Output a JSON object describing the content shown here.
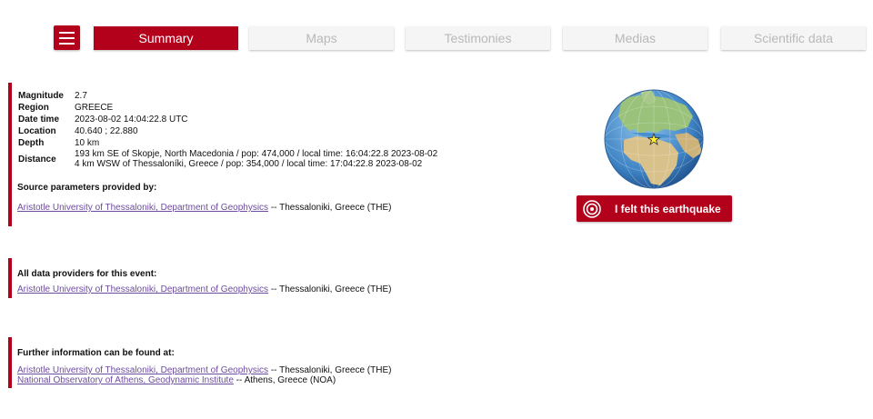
{
  "nav": {
    "tabs": [
      {
        "label": "Summary",
        "active": true
      },
      {
        "label": "Maps",
        "active": false
      },
      {
        "label": "Testimonies",
        "active": false
      },
      {
        "label": "Medias",
        "active": false
      },
      {
        "label": "Scientific data",
        "active": false
      }
    ],
    "menu_icon": "hamburger-menu-icon"
  },
  "event": {
    "rows": [
      {
        "key": "Magnitude",
        "value": "2.7"
      },
      {
        "key": "Region",
        "value": "GREECE"
      },
      {
        "key": "Date time",
        "value": "2023-08-02 14:04:22.8 UTC"
      },
      {
        "key": "Location",
        "value": "40.640 ; 22.880"
      },
      {
        "key": "Depth",
        "value": "10 km"
      }
    ],
    "distance_key": "Distance",
    "distance_lines": [
      "193 km SE of Skopje, North Macedonia / pop: 474,000 / local time: 16:04:22.8 2023-08-02",
      "4 km WSW of Thessaloníki, Greece / pop: 354,000 / local time: 17:04:22.8 2023-08-02"
    ]
  },
  "source": {
    "heading": "Source parameters provided by:",
    "link": "Aristotle University of Thessaloniki, Department of Geophysics",
    "suffix": " -- Thessaloniki, Greece (THE)"
  },
  "providers": {
    "heading": "All data providers for this event:",
    "items": [
      {
        "link": "Aristotle University of Thessaloniki, Department of Geophysics",
        "suffix": " -- Thessaloniki, Greece (THE)"
      }
    ]
  },
  "further": {
    "heading": "Further information can be found at:",
    "items": [
      {
        "link": "Aristotle University of Thessaloniki, Department of Geophysics",
        "suffix": " -- Thessaloniki, Greece (THE)"
      },
      {
        "link": "National Observatory of Athens, Geodynamic Institute",
        "suffix": " -- Athens, Greece (NOA)"
      }
    ]
  },
  "felt_button": {
    "label": "I felt this earthquake",
    "icon": "target-icon"
  },
  "colors": {
    "accent": "#b3001b",
    "link": "#6d4c9f",
    "tab_inactive_text": "#b9b9b9"
  }
}
